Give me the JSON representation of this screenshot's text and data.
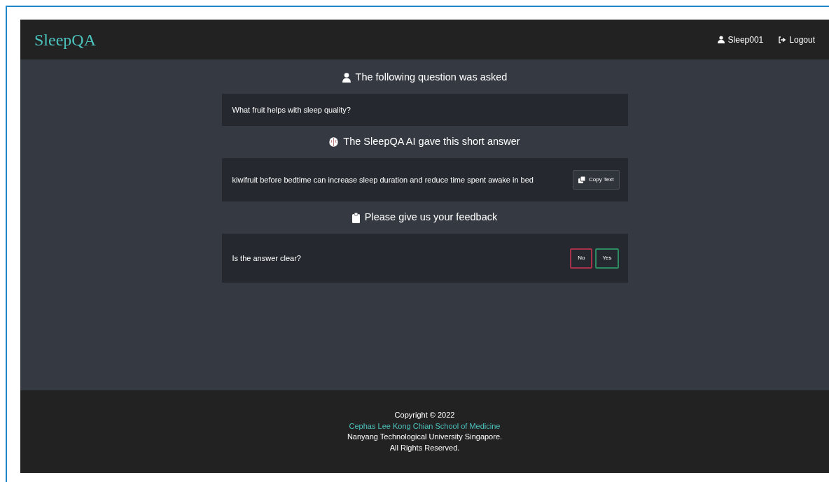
{
  "header": {
    "logo": "SleepQA",
    "user": "Sleep001",
    "logout": "Logout"
  },
  "sections": [
    {
      "heading": "The following question was asked",
      "text": "What fruit helps with sleep quality?",
      "kind": "text"
    },
    {
      "heading": "The SleepQA AI gave this short answer",
      "text": "kiwifruit before bedtime can increase sleep duration and reduce time spent awake in bed",
      "kind": "copy",
      "button": "Copy Text"
    },
    {
      "heading": "Please give us your feedback",
      "text": "Is the answer clear?",
      "kind": "feedback",
      "buttons": [
        {
          "label": "No",
          "color": "#a8324a"
        },
        {
          "label": "Yes",
          "color": "#2e8a60"
        }
      ]
    }
  ],
  "footer": {
    "copyright": "Copyright © 2022",
    "school": "Cephas Lee Kong Chian School of Medicine",
    "university": "Nanyang Technological University Singapore.",
    "rights": "All Rights Reserved."
  }
}
